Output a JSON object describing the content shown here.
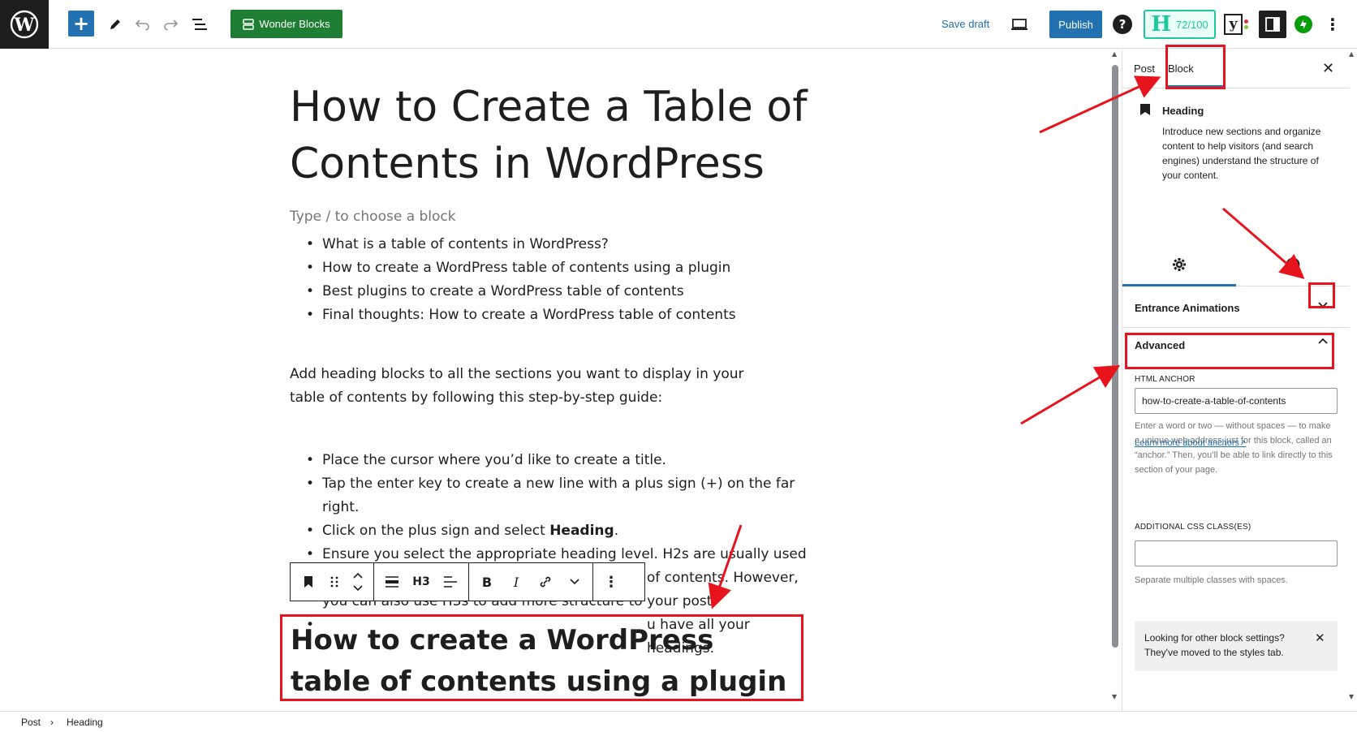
{
  "topbar": {
    "wonder_blocks_label": "Wonder Blocks",
    "save_draft_label": "Save draft",
    "publish_label": "Publish",
    "help_label": "?",
    "seo_letter": "H",
    "seo_score": "72/100",
    "yoast_label": "y"
  },
  "editor": {
    "post_title": "How to Create a Table of Contents in WordPress",
    "block_placeholder": "Type / to choose a block",
    "toc_list": [
      "What is a table of contents in WordPress?",
      "How to create a WordPress table of contents using a plugin",
      "Best plugins to create a WordPress table of contents",
      "Final thoughts: How to create a WordPress table of contents"
    ],
    "paragraph": "Add heading blocks to all the sections you want to display in your table of contents by following this step-by-step guide:",
    "steps": {
      "s1": "Place the cursor where you’d like to create a title.",
      "s2": "Tap the enter key to create a new line with a plus sign (+) on the far right.",
      "s3_prefix": "Click on the plus sign and select ",
      "s3_bold": "Heading",
      "s3_suffix": ".",
      "s4": "Ensure you select the appropriate heading level. H2s are usually used for headings appearing in the WordPress table of contents. However, you can also use H3s to add more structure to your post.",
      "s5_visible": "u have all your headings."
    },
    "toolbar": {
      "heading_level": "H3",
      "bold": "B",
      "italic": "I"
    },
    "selected_heading": "How to create a WordPress table of contents using a plugin"
  },
  "sidebar": {
    "tabs": [
      "Post",
      "Block"
    ],
    "active_tab": "Block",
    "block_name": "Heading",
    "block_description": "Introduce new sections and organize content to help visitors (and search engines) understand the structure of your content.",
    "panels": {
      "entrance_animations": "Entrance Animations",
      "advanced": "Advanced"
    },
    "html_anchor_label": "HTML ANCHOR",
    "html_anchor_value": "how-to-create-a-table-of-contents",
    "html_anchor_help": "Enter a word or two — without spaces — to make a unique web address just for this block, called an “anchor.” Then, you’ll be able to link directly to this section of your page.",
    "learn_more_link": "Learn more about anchors",
    "css_classes_label": "ADDITIONAL CSS CLASS(ES)",
    "css_classes_value": "",
    "css_classes_help": "Separate multiple classes with spaces.",
    "notice_text": "Looking for other block settings? They've moved to the styles tab."
  },
  "footer": {
    "breadcrumb": [
      "Post",
      "Heading"
    ]
  },
  "colors": {
    "accent": "#2271b1",
    "annotation": "#e8141d",
    "wonder_green": "#1e7e34",
    "seo_green": "#1ec99b"
  }
}
